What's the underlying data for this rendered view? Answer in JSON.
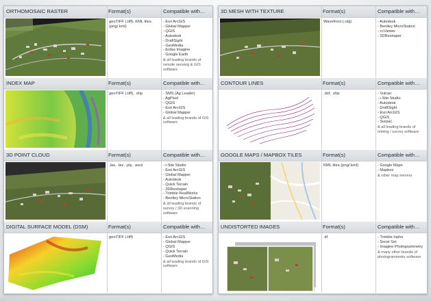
{
  "left": [
    {
      "title": "ORTHOMOSAIC RASTER",
      "format_header": "Format(s)",
      "compat_header": "Compatible with…",
      "formats": [
        "geoTIFF (.tiff), KML tiles",
        "(png/.kml)"
      ],
      "compatible": [
        "- Esri ArcGIS",
        "- Global Mapper",
        "- QGIS",
        "- Autodesk",
        "- DraftSight",
        "- GeoMedia",
        "- Erdas Imagine",
        "- Google Earth"
      ],
      "note": "& all leading brands of remote sensing & GIS software",
      "thumbnail": "orthomosaic-image"
    },
    {
      "title": "INDEX MAP",
      "format_header": "Format(s)",
      "compat_header": "Compatible with…",
      "formats": [
        "geoTIFF (.tiff), .shp"
      ],
      "compatible": [
        "- SMS (Ag Leader)",
        "- AgPixel",
        "- QGIS",
        "- Esri ArcGIS",
        "- Global Mapper"
      ],
      "note": "& all leading brands of GIS software",
      "thumbnail": "index-map-image"
    },
    {
      "title": "3D POINT CLOUD",
      "format_header": "Format(s)",
      "compat_header": "Compatible with…",
      "formats": [
        ".las, .laz, .ply, .ascii"
      ],
      "compatible": [
        "- i-Site Studio",
        "- Esri ArcGIS",
        "- Global Mapper",
        "- Autodesk",
        "- Quick Terrain",
        "- 3DReshaper",
        "- Trimble RealWorks",
        "- Bentley MicroStation"
      ],
      "note": "& all leading brands of survey / 3D scanning software",
      "thumbnail": "point-cloud-image"
    },
    {
      "title": "DIGITAL SURFACE MODEL (DSM)",
      "format_header": "Format(s)",
      "compat_header": "Compatible with…",
      "formats": [
        "geoTIFF (.tiff)"
      ],
      "compatible": [
        "- Esri ArcGIS",
        "- Global Mapper",
        "- QGIS",
        "- Quick Terrain",
        "- GeoMedia"
      ],
      "note": "& all leading brands of GIS software",
      "thumbnail": "dsm-image"
    }
  ],
  "right": [
    {
      "title": "3D MESH WITH TEXTURE",
      "format_header": "Format(s)",
      "compat_header": "Compatible with…",
      "formats": [
        "Wavefront (.obj)"
      ],
      "compatible": [
        "- Autodesk",
        "- Bentley MicroStation",
        "- ccViewer",
        "- 3DReshaper"
      ],
      "note": "",
      "thumbnail": "mesh-image"
    },
    {
      "title": "CONTOUR LINES",
      "format_header": "Format(s)",
      "compat_header": "Compatible with…",
      "formats": [
        ".dxf, .shp"
      ],
      "compatible": [
        "- Vulcan",
        "- i-Site Studio",
        "- Autodesk",
        "- DraftSight",
        "- Esri ArcGIS",
        "- QGIS",
        "- Surpac"
      ],
      "note": "& all leading brands of mining / survey software",
      "thumbnail": "contour-image"
    },
    {
      "title": "GOOGLE MAPS / MAPBOX TILES",
      "format_header": "Format(s)",
      "compat_header": "Compatible with…",
      "formats": [
        "KML tiles (png/.kml)"
      ],
      "compatible": [
        "- Google Maps",
        "- Mapbox"
      ],
      "note": "& other map servers",
      "thumbnail": "map-tiles-image"
    },
    {
      "title": "UNDISTORTED IMAGES",
      "format_header": "Format(s)",
      "compat_header": "Compatible with…",
      "formats": [
        ".tif"
      ],
      "compatible": [
        "- Trimble Inpho",
        "- Socet Set",
        "- Imagine Photogrammetry"
      ],
      "note": "& many other brands of photogrammetry software",
      "thumbnail": "undistorted-image"
    }
  ]
}
